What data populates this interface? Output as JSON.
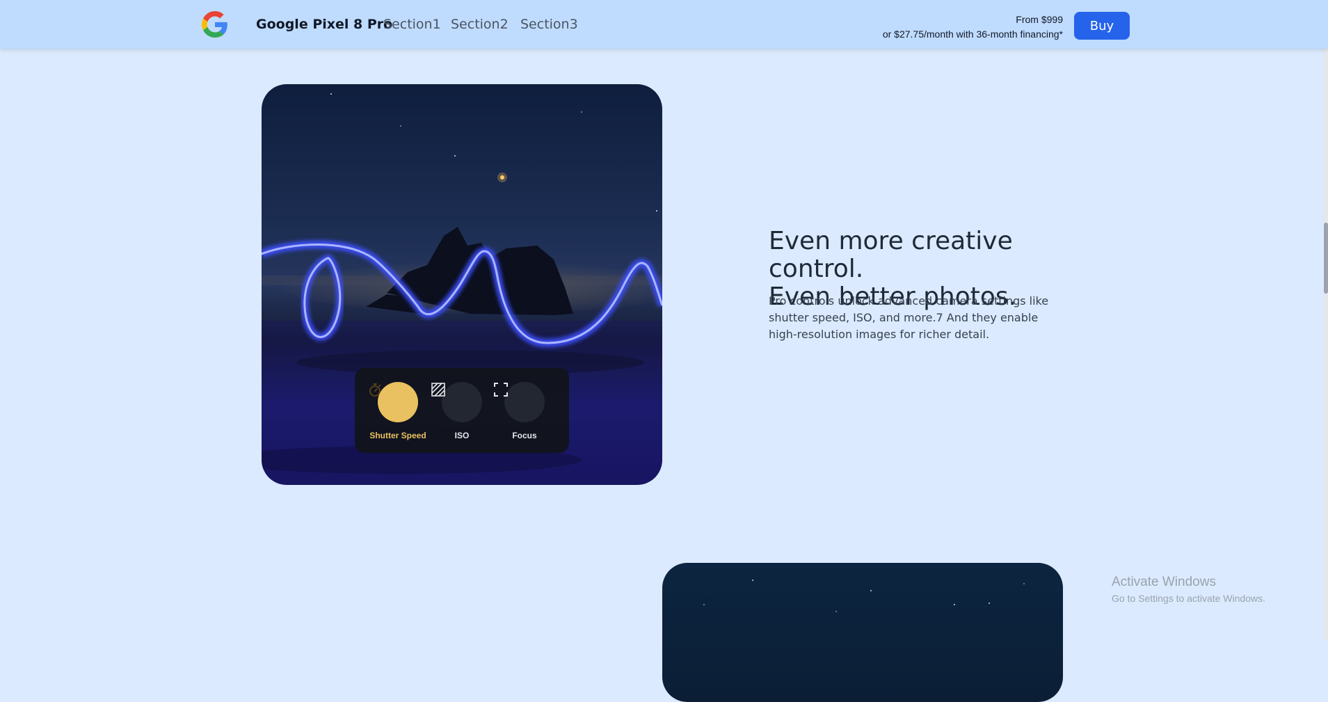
{
  "header": {
    "brand": "Google Pixel 8 Pro",
    "nav": [
      "Section1",
      "Section2",
      "Section3"
    ],
    "price_line1": "From $999",
    "price_line2": "or $27.75/month with 36-month financing*",
    "buy_label": "Buy",
    "logo_icon": "google-g-logo"
  },
  "feature": {
    "headline_line1": "Even more creative control.",
    "headline_line2": "Even better photos.",
    "body": "Pro controls unlock advanced camera settings like shutter speed, ISO, and more.7 And they enable high-resolution images for richer detail."
  },
  "camera_controls": [
    {
      "label": "Shutter Speed",
      "icon": "stopwatch-icon",
      "active": true
    },
    {
      "label": "ISO",
      "icon": "iso-hatch-icon",
      "active": false
    },
    {
      "label": "Focus",
      "icon": "focus-frame-icon",
      "active": false
    }
  ],
  "watermark": {
    "line1": "Activate Windows",
    "line2": "Go to Settings to activate Windows."
  },
  "colors": {
    "page_bg": "#dbeafe",
    "header_bg": "#bfdbfe",
    "buy_bg": "#2563eb",
    "active_control": "#eac160"
  }
}
